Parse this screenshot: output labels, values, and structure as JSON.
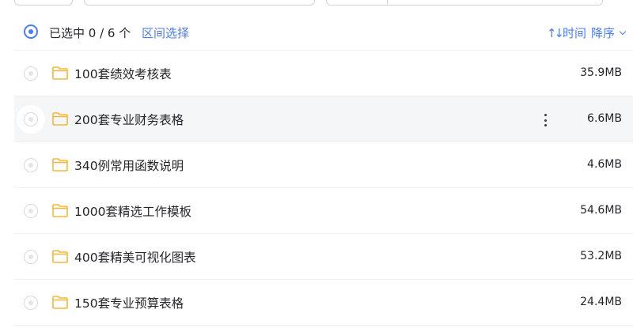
{
  "selection": {
    "status_text": "已选中 0 / 6 个",
    "range_select_label": "区间选择"
  },
  "sort": {
    "icon": "sort-updown-icon",
    "field_label": "时间",
    "order_label": "降序"
  },
  "colors": {
    "accent": "#4a7cf7",
    "folder": "#f4b738",
    "row_hover": "#f5f6f8",
    "text": "#25262b"
  },
  "files": [
    {
      "name": "100套绩效考核表",
      "size": "35.9MB",
      "icon": "folder-icon"
    },
    {
      "name": "200套专业财务表格",
      "size": "6.6MB",
      "icon": "folder-icon",
      "hovered": true
    },
    {
      "name": "340例常用函数说明",
      "size": "4.6MB",
      "icon": "folder-icon"
    },
    {
      "name": "1000套精选工作模板",
      "size": "54.6MB",
      "icon": "folder-icon"
    },
    {
      "name": "400套精美可视化图表",
      "size": "53.2MB",
      "icon": "folder-icon"
    },
    {
      "name": "150套专业预算表格",
      "size": "24.4MB",
      "icon": "folder-icon"
    }
  ]
}
